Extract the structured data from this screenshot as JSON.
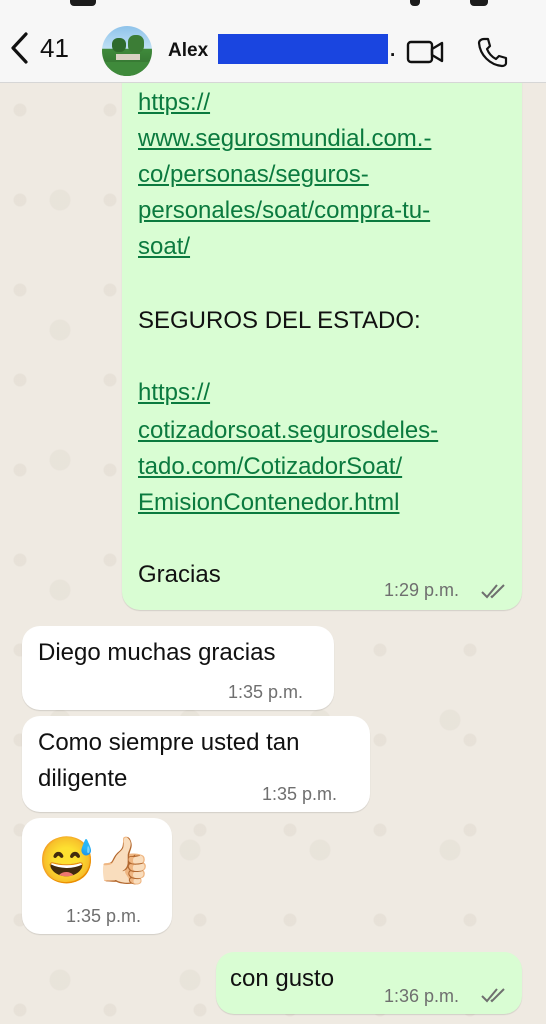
{
  "header": {
    "back_count": "41",
    "contact_name": "Alex",
    "name_suffix": "."
  },
  "messages": {
    "soat_message": {
      "link1": [
        "https://",
        "www.segurosmundial.com.-",
        "co/personas/seguros-",
        "personales/soat/compra-tu-",
        "soat/"
      ],
      "heading": "SEGUROS DEL ESTADO:",
      "link2": [
        "https://",
        "cotizadorsoat.segurosdeles-",
        "tado.com/CotizadorSoat/",
        "EmisionContenedor.html"
      ],
      "closing": "Gracias",
      "time": "1:29 p.m.",
      "status": "read"
    },
    "thanks": {
      "text": "Diego muchas gracias",
      "time": "1:35 p.m."
    },
    "diligent": {
      "lines": [
        "Como siempre usted tan",
        "diligente"
      ],
      "time": "1:35 p.m."
    },
    "emoji_msg": {
      "emojis": "😅👍🏻",
      "time": "1:35 p.m."
    },
    "reply": {
      "text": "con gusto",
      "time": "1:36 p.m.",
      "status": "read"
    }
  },
  "colors": {
    "outgoing_bubble": "#d9fdd3",
    "incoming_bubble": "#ffffff",
    "link": "#0b7a3f",
    "redaction": "#1a45e0",
    "read_ticks": "#6f6f6f"
  },
  "icons": {
    "back": "chevron-left-icon",
    "video": "video-camera-icon",
    "call": "phone-icon",
    "read": "double-check-icon"
  }
}
